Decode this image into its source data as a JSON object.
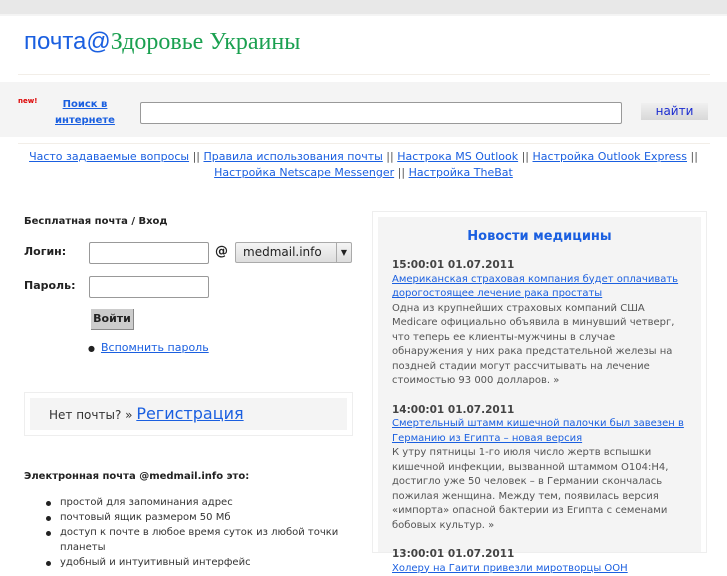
{
  "header": {
    "logo_part1": "почта@",
    "logo_part2": "Здоровье Украины"
  },
  "search": {
    "new_badge": "new!",
    "link_label": "Поиск в интернете",
    "input_value": "",
    "button_label": "найти"
  },
  "nav_links": [
    "Часто задаваемые вопросы",
    "Правила использования почты",
    "Настрока MS Outlook",
    "Настройка Outlook Express",
    "Настройка Netscape Messenger",
    "Настройка TheBat"
  ],
  "nav_separator": "||",
  "login": {
    "heading": "Бесплатная почта / Вход",
    "login_label": "Логин:",
    "login_value": "",
    "at": "@",
    "domain_selected": "medmail.info",
    "password_label": "Пароль:",
    "password_value": "",
    "submit_label": "Войти",
    "forgot_label": "Вспомнить пароль"
  },
  "register": {
    "prompt": "Нет почты? »",
    "link_label": "Регистрация"
  },
  "features": {
    "heading": "Электронная почта @medmail.info это:",
    "items": [
      "простой для запоминания адрес",
      "почтовый ящик размером 50 Мб",
      "доступ к почте в любое время суток из любой точки планеты",
      "удобный и интуитивный интерфейс"
    ]
  },
  "news": {
    "title": "Новости медицины",
    "items": [
      {
        "time": "15:00:01  01.07.2011",
        "headline": "Американская страховая компания будет оплачивать дорогостоящее лечение рака простаты",
        "text": "Одна из крупнейших страховых компаний США Medicare официально объявила в минувший четверг, что теперь ее клиенты-мужчины в случае обнаружения у них рака предстательной железы на поздней стадии могут рассчитывать на лечение стоимостью 93 000 долларов. »"
      },
      {
        "time": "14:00:01  01.07.2011",
        "headline": "Смертельный штамм кишечной палочки был завезен в Германию из Египта – новая версия",
        "text": "К утру пятницы 1-го июля число жертв вспышки кишечной инфекции, вызванной штаммом O104:H4, достигло уже 50 человек – в Германии скончалась пожилая женщина. Между тем, появилась версия «импорта» опасной бактерии из Египта с семенами бобовых культур. »"
      },
      {
        "time": "13:00:01  01.07.2011",
        "headline": "Холеру на Гаити привезли миротворцы ООН",
        "text": ""
      }
    ]
  }
}
